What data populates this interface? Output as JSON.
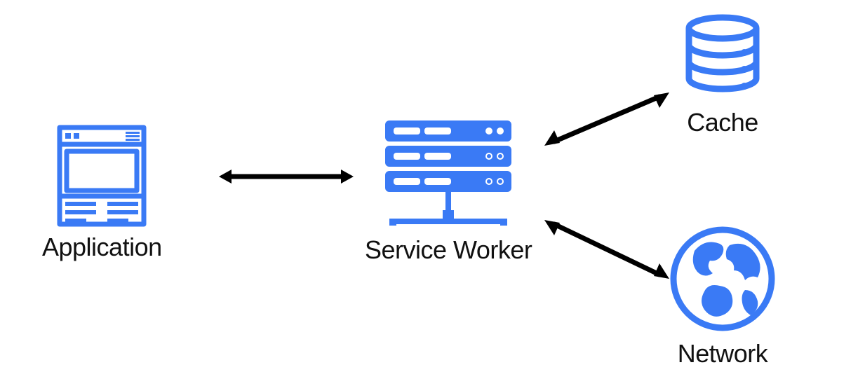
{
  "nodes": {
    "application": {
      "label": "Application"
    },
    "service_worker": {
      "label": "Service Worker"
    },
    "cache": {
      "label": "Cache"
    },
    "network": {
      "label": "Network"
    }
  },
  "edges": [
    {
      "from": "application",
      "to": "service_worker",
      "bidirectional": true
    },
    {
      "from": "service_worker",
      "to": "cache",
      "bidirectional": true
    },
    {
      "from": "service_worker",
      "to": "network",
      "bidirectional": true
    }
  ],
  "colors": {
    "icon": "#3a7af5",
    "arrow": "#000000",
    "text": "#111111"
  }
}
